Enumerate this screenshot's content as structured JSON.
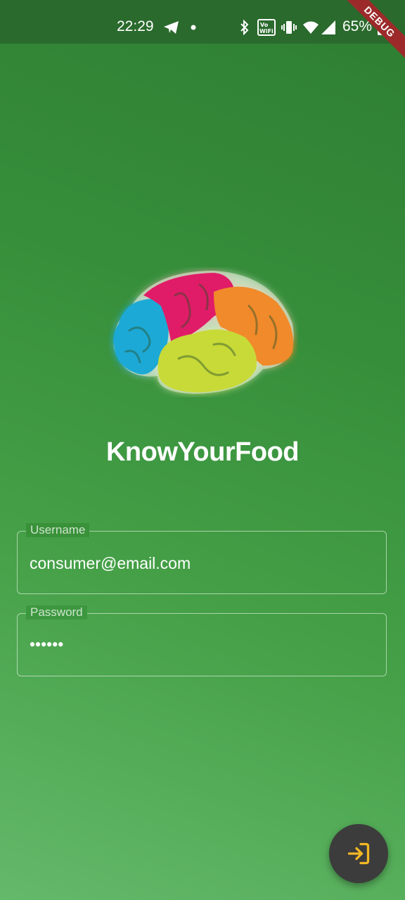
{
  "status_bar": {
    "time": "22:29",
    "battery": "65%",
    "icons": [
      "telegram-icon",
      "dot-icon",
      "bluetooth-icon",
      "vowifi-icon",
      "vibrate-icon",
      "wifi-icon",
      "signal-icon",
      "battery-icon"
    ]
  },
  "debug_banner": "DEBUG",
  "app": {
    "title": "KnowYourFood",
    "logo": "brain-logo"
  },
  "form": {
    "username": {
      "label": "Username",
      "value": "consumer@email.com"
    },
    "password": {
      "label": "Password",
      "value": "••••••"
    }
  },
  "fab": {
    "icon": "login-icon",
    "color": "#f2b824"
  },
  "colors": {
    "background": "#388e3c",
    "fab": "#3c3c3c",
    "accent": "#f2b824"
  }
}
